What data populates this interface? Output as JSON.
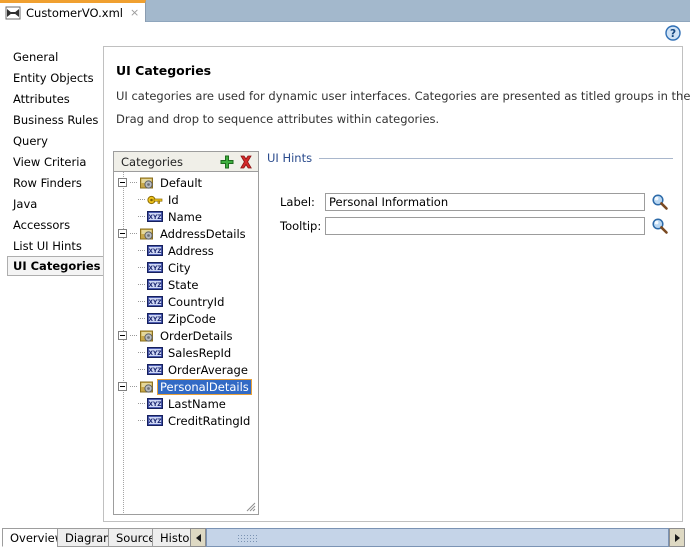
{
  "window": {
    "tab": {
      "title": "CustomerVO.xml",
      "icon": "xml-document-icon",
      "close_label": "×"
    },
    "help_icon": "help-question-icon"
  },
  "sidebar": {
    "items": [
      {
        "label": "General",
        "selected": false
      },
      {
        "label": "Entity Objects",
        "selected": false
      },
      {
        "label": "Attributes",
        "selected": false
      },
      {
        "label": "Business Rules",
        "selected": false
      },
      {
        "label": "Query",
        "selected": false
      },
      {
        "label": "View Criteria",
        "selected": false
      },
      {
        "label": "Row Finders",
        "selected": false
      },
      {
        "label": "Java",
        "selected": false
      },
      {
        "label": "Accessors",
        "selected": false
      },
      {
        "label": "List UI Hints",
        "selected": false
      },
      {
        "label": "UI Categories",
        "selected": true
      }
    ]
  },
  "content": {
    "title": "UI Categories",
    "description_line1": "UI categories are used for dynamic user interfaces. Categories are presented as titled groups in the UI.",
    "description_line2": "Drag and drop to sequence attributes within categories."
  },
  "categories_panel": {
    "header_label": "Categories",
    "add_button": {
      "name": "add-category-button",
      "glyph": "+",
      "color": "#3a9a3a"
    },
    "delete_button": {
      "name": "delete-category-button",
      "glyph": "✖",
      "color": "#cc2222"
    },
    "tree": [
      {
        "label": "Default",
        "icon": "category-gear-icon",
        "expanded": true,
        "selected": false,
        "children": [
          {
            "label": "Id",
            "icon": "primary-key-icon",
            "selected": false
          },
          {
            "label": "Name",
            "icon": "attribute-xyz-icon",
            "selected": false
          }
        ]
      },
      {
        "label": "AddressDetails",
        "icon": "category-gear-icon",
        "expanded": true,
        "selected": false,
        "children": [
          {
            "label": "Address",
            "icon": "attribute-xyz-icon",
            "selected": false
          },
          {
            "label": "City",
            "icon": "attribute-xyz-icon",
            "selected": false
          },
          {
            "label": "State",
            "icon": "attribute-xyz-icon",
            "selected": false
          },
          {
            "label": "CountryId",
            "icon": "attribute-xyz-icon",
            "selected": false
          },
          {
            "label": "ZipCode",
            "icon": "attribute-xyz-icon",
            "selected": false
          }
        ]
      },
      {
        "label": "OrderDetails",
        "icon": "category-gear-icon",
        "expanded": true,
        "selected": false,
        "children": [
          {
            "label": "SalesRepId",
            "icon": "attribute-xyz-icon",
            "selected": false
          },
          {
            "label": "OrderAverage",
            "icon": "attribute-xyz-icon",
            "selected": false
          }
        ]
      },
      {
        "label": "PersonalDetails",
        "icon": "category-gear-icon",
        "expanded": true,
        "selected": true,
        "children": [
          {
            "label": "LastName",
            "icon": "attribute-xyz-icon",
            "selected": false
          },
          {
            "label": "CreditRatingId",
            "icon": "attribute-xyz-icon",
            "selected": false
          }
        ]
      }
    ]
  },
  "ui_hints": {
    "legend": "UI Hints",
    "fields": [
      {
        "label": "Label:",
        "value": "Personal Information",
        "placeholder": "",
        "browse_icon": "magnifier-icon"
      },
      {
        "label": "Tooltip:",
        "value": "",
        "placeholder": "",
        "browse_icon": "magnifier-icon"
      }
    ]
  },
  "bottom_tabs": {
    "items": [
      {
        "label": "Overview",
        "active": true
      },
      {
        "label": "Diagram",
        "active": false
      },
      {
        "label": "Source",
        "active": false
      },
      {
        "label": "History",
        "active": false
      }
    ],
    "scroll_left_icon": "triangle-left-icon",
    "scroll_right_icon": "triangle-right-icon"
  },
  "colors": {
    "tabstrip_bg": "#a3b8cc",
    "tab_accent": "#f0a030",
    "selection_blue": "#316ac5",
    "selection_border": "#e8a13a",
    "legend_text": "#2a4b8d",
    "scrollbar_track": "#c5d4e8"
  }
}
